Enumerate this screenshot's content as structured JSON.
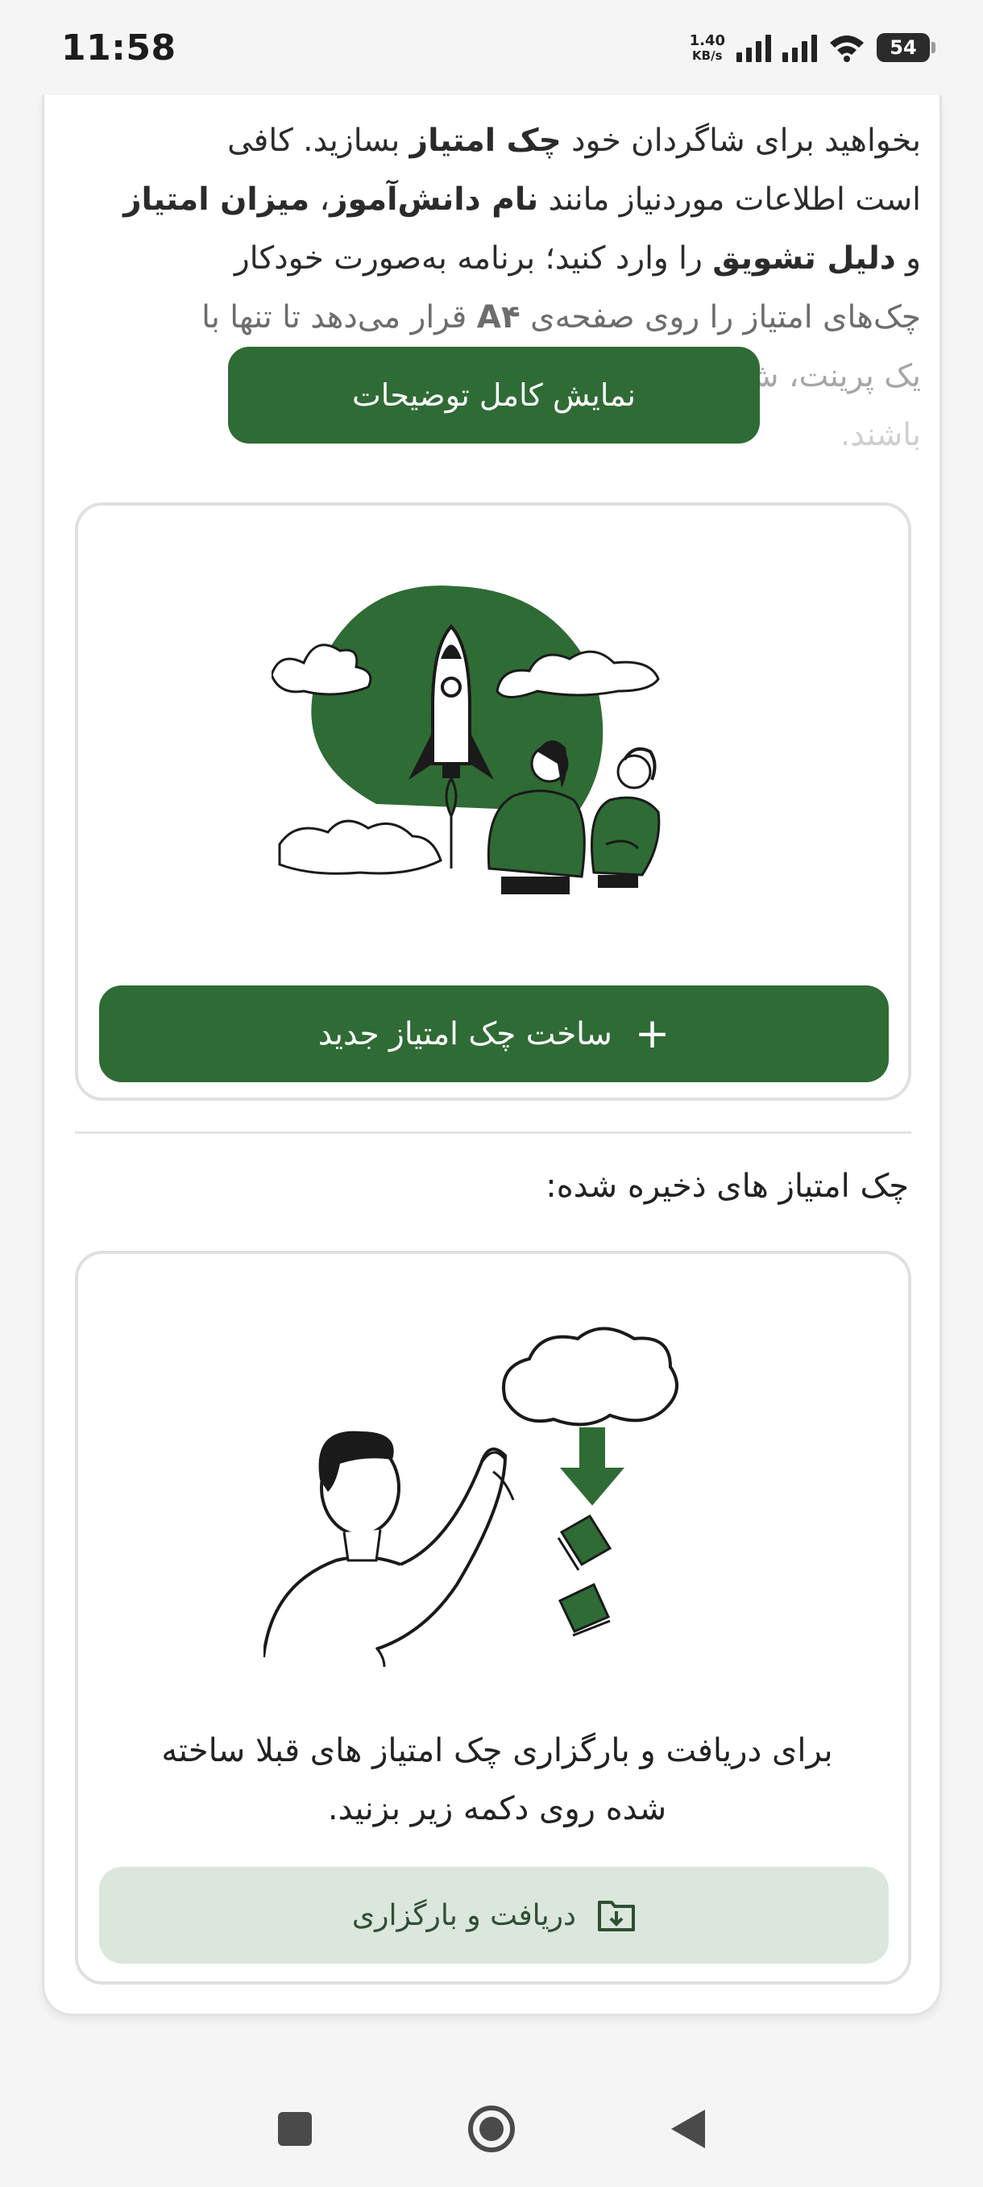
{
  "status_bar": {
    "time": "11:58",
    "net_speed_value": "1.40",
    "net_speed_unit": "KB/s",
    "battery": "54"
  },
  "description": {
    "lines": [
      {
        "parts": [
          {
            "t": "بخواهید برای شاگردان خود "
          },
          {
            "t": "چک امتیاز",
            "b": true
          },
          {
            "t": " بسازید. کافی"
          }
        ]
      },
      {
        "parts": [
          {
            "t": "است اطلاعات موردنیاز مانند "
          },
          {
            "t": "نام دانش‌آموز",
            "b": true
          },
          {
            "t": "، "
          },
          {
            "t": "میزان امتیاز",
            "b": true
          }
        ]
      },
      {
        "parts": [
          {
            "t": "و "
          },
          {
            "t": "دلیل تشویق",
            "b": true
          },
          {
            "t": " را وارد کنید؛ برنامه به‌صورت خودکار"
          }
        ]
      },
      {
        "parts": [
          {
            "t": "چک‌های امتیاز را روی صفحه‌ی "
          },
          {
            "t": "A۴",
            "b": true
          },
          {
            "t": " قرار می‌دهد تا تنها با"
          }
        ]
      },
      {
        "parts": [
          {
            "t": "یک پرینت،"
          },
          {
            "t": "                                        "
          },
          {
            "t": "ش‌آموز"
          }
        ]
      },
      {
        "parts": [
          {
            "t": "باشند."
          }
        ]
      }
    ]
  },
  "show_more_label": "نمایش کامل توضیحات",
  "create_button": {
    "label": "ساخت چک امتیاز جدید",
    "icon": "plus-icon"
  },
  "saved_section_title": "چک امتیاز های ذخیره شده:",
  "download_card": {
    "text": "برای دریافت و بارگزاری چک امتیاز های قبلا ساخته شده روی دکمه زیر بزنید.",
    "button_label": "دریافت و بارگزاری",
    "button_icon": "download-folder-icon"
  },
  "colors": {
    "primary": "#2f6b35",
    "secondary_bg": "#dbe6dc",
    "border": "#e0e0e0"
  }
}
